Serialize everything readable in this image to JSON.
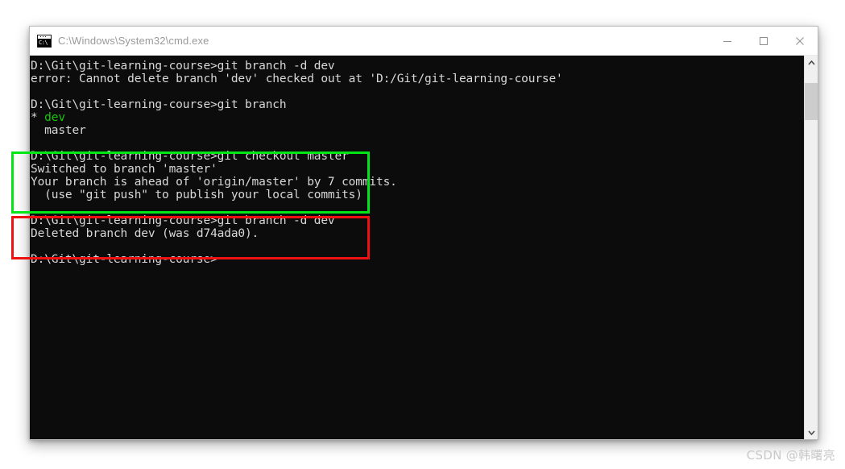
{
  "window": {
    "title": "C:\\Windows\\System32\\cmd.exe",
    "icon_name": "cmd-icon",
    "icon_text": "C:\\",
    "controls": {
      "minimize_label": "Minimize",
      "maximize_label": "Maximize",
      "close_label": "Close"
    }
  },
  "console": {
    "background_color": "#0c0c0c",
    "text_color": "#d8d8d8",
    "highlight_color": "#16c60c",
    "prompt": "D:\\Git\\git-learning-course>",
    "lines": [
      {
        "text": "D:\\Git\\git-learning-course>git branch -d dev",
        "color": "default"
      },
      {
        "text": "error: Cannot delete branch 'dev' checked out at 'D:/Git/git-learning-course'",
        "color": "default"
      },
      {
        "text": "",
        "color": "default"
      },
      {
        "text": "D:\\Git\\git-learning-course>git branch",
        "color": "default"
      },
      {
        "text": "* dev",
        "color": "green"
      },
      {
        "text": "  master",
        "color": "default"
      },
      {
        "text": "",
        "color": "default"
      },
      {
        "text": "D:\\Git\\git-learning-course>git checkout master",
        "color": "default"
      },
      {
        "text": "Switched to branch 'master'",
        "color": "default"
      },
      {
        "text": "Your branch is ahead of 'origin/master' by 7 commits.",
        "color": "default"
      },
      {
        "text": "  (use \"git push\" to publish your local commits)",
        "color": "default"
      },
      {
        "text": "",
        "color": "default"
      },
      {
        "text": "D:\\Git\\git-learning-course>git branch -d dev",
        "color": "default"
      },
      {
        "text": "Deleted branch dev (was d74ada0).",
        "color": "default"
      },
      {
        "text": "",
        "color": "default"
      },
      {
        "text": "D:\\Git\\git-learning-course>",
        "color": "default"
      }
    ]
  },
  "scrollbar": {
    "up_icon": "chevron-up-icon",
    "down_icon": "chevron-down-icon"
  },
  "annotations": [
    {
      "name": "green-highlight-box",
      "color": "#00e616"
    },
    {
      "name": "red-highlight-box",
      "color": "#ee1111"
    }
  ],
  "watermark": {
    "text": "CSDN @韩曙亮"
  }
}
